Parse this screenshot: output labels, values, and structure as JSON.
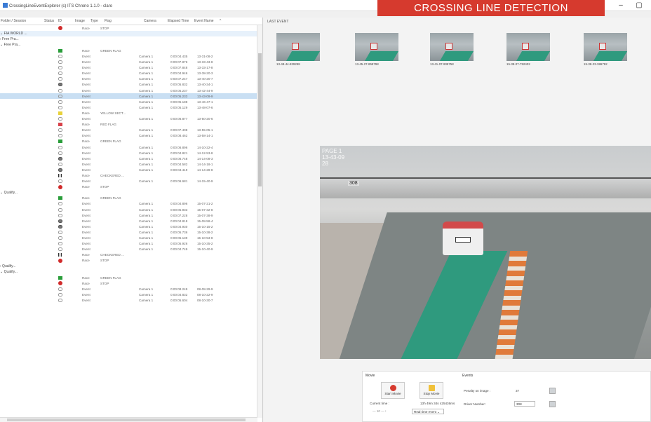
{
  "window": {
    "title": "CrossingLineEventExplorer (c) ITS Chrono 1.1.0 - claro"
  },
  "banner": {
    "text": "CROSSING LINE DETECTION"
  },
  "window_controls": {
    "minimize": "–",
    "restore": "▢"
  },
  "tree": {
    "columns": [
      "Folder / Session",
      "Status",
      "ID",
      "Image",
      "Type",
      "Flag",
      "Camera",
      "Elapsed Time",
      "Event Name"
    ],
    "sort_indicator": "^",
    "rows": [
      {
        "folder": "",
        "status": "stop",
        "type": "Race",
        "flag": "STOP",
        "camera": "",
        "elapsed": "",
        "event": ""
      },
      {
        "folder": "⌄ FIA WORLD ...",
        "status": "",
        "type": "",
        "flag": "",
        "camera": "",
        "elapsed": "",
        "event": "",
        "style": "hl"
      },
      {
        "folder": "  › Free Pra...",
        "status": "",
        "type": "",
        "flag": "",
        "camera": "",
        "elapsed": "",
        "event": ""
      },
      {
        "folder": "  ⌄ Free Pra...",
        "status": "",
        "type": "",
        "flag": "",
        "camera": "",
        "elapsed": "",
        "event": ""
      },
      {
        "folder": "",
        "status": "green",
        "type": "Race",
        "flag": "GREEN FLAG",
        "camera": "",
        "elapsed": "",
        "event": ""
      },
      {
        "folder": "",
        "status": "event",
        "type": "Event",
        "flag": "",
        "camera": "Camera 1",
        "elapsed": "0:00:04.435",
        "event": "13-31-08-2"
      },
      {
        "folder": "",
        "status": "event",
        "type": "Event",
        "flag": "",
        "camera": "Camera 1",
        "elapsed": "0:00:07.876",
        "event": "13-33-43-8"
      },
      {
        "folder": "",
        "status": "event",
        "type": "Event",
        "flag": "",
        "camera": "Camera 1",
        "elapsed": "0:00:07.848",
        "event": "13-33-17-8"
      },
      {
        "folder": "",
        "status": "event",
        "type": "Event",
        "flag": "",
        "camera": "Camera 1",
        "elapsed": "0:00:04.946",
        "event": "13-38-20-3"
      },
      {
        "folder": "",
        "status": "event",
        "type": "Event",
        "flag": "",
        "camera": "Camera 1",
        "elapsed": "0:00:07.247",
        "event": "13-40-20-7"
      },
      {
        "folder": "",
        "status": "event-dark",
        "type": "Event",
        "flag": "",
        "camera": "Camera 1",
        "elapsed": "0:00:05.832",
        "event": "13-40-34-1"
      },
      {
        "folder": "",
        "status": "event",
        "type": "Event",
        "flag": "",
        "camera": "Camera 1",
        "elapsed": "0:00:05.237",
        "event": "13-42-44-9"
      },
      {
        "folder": "",
        "status": "event",
        "type": "Event",
        "flag": "",
        "camera": "Camera 1",
        "elapsed": "0:00:05.233",
        "event": "13-43-09-9",
        "style": "sel"
      },
      {
        "folder": "",
        "status": "event",
        "type": "Event",
        "flag": "",
        "camera": "Camera 1",
        "elapsed": "0:00:05.188",
        "event": "13-46-47-1"
      },
      {
        "folder": "",
        "status": "event",
        "type": "Event",
        "flag": "",
        "camera": "Camera 1",
        "elapsed": "0:00:05.129",
        "event": "13-48-07-6"
      },
      {
        "folder": "",
        "status": "yellow",
        "type": "Race",
        "flag": "YELLOW SECT...",
        "camera": "",
        "elapsed": "",
        "event": ""
      },
      {
        "folder": "",
        "status": "event",
        "type": "Event",
        "flag": "",
        "camera": "Camera 1",
        "elapsed": "0:00:06.877",
        "event": "13-50-20-6"
      },
      {
        "folder": "",
        "status": "red",
        "type": "Race",
        "flag": "RED FLAG",
        "camera": "",
        "elapsed": "",
        "event": ""
      },
      {
        "folder": "",
        "status": "event",
        "type": "Event",
        "flag": "",
        "camera": "Camera 1",
        "elapsed": "0:00:07.408",
        "event": "13-55-05-1"
      },
      {
        "folder": "",
        "status": "event",
        "type": "Event",
        "flag": "",
        "camera": "Camera 1",
        "elapsed": "0:00:08.462",
        "event": "13-58-14-1"
      },
      {
        "folder": "",
        "status": "green",
        "type": "Race",
        "flag": "GREEN FLAG",
        "camera": "",
        "elapsed": "",
        "event": ""
      },
      {
        "folder": "",
        "status": "event",
        "type": "Event",
        "flag": "",
        "camera": "Camera 1",
        "elapsed": "0:00:06.896",
        "event": "14-10-22-4"
      },
      {
        "folder": "",
        "status": "event",
        "type": "Event",
        "flag": "",
        "camera": "Camera 1",
        "elapsed": "0:00:04.821",
        "event": "14-12-53-8"
      },
      {
        "folder": "",
        "status": "event-dark",
        "type": "Event",
        "flag": "",
        "camera": "Camera 1",
        "elapsed": "0:00:06.748",
        "event": "14-14-08-3"
      },
      {
        "folder": "",
        "status": "event",
        "type": "Event",
        "flag": "",
        "camera": "Camera 1",
        "elapsed": "0:00:04.582",
        "event": "14-14-18-1"
      },
      {
        "folder": "",
        "status": "event-dark",
        "type": "Event",
        "flag": "",
        "camera": "Camera 1",
        "elapsed": "0:00:04.419",
        "event": "14-14-28-8"
      },
      {
        "folder": "",
        "status": "check",
        "type": "Race",
        "flag": "CHECKERED ...",
        "camera": "",
        "elapsed": "",
        "event": ""
      },
      {
        "folder": "",
        "status": "event",
        "type": "Event",
        "flag": "",
        "camera": "Camera 1",
        "elapsed": "0:00:06.681",
        "event": "14-15-40-9"
      },
      {
        "folder": "",
        "status": "stop",
        "type": "Race",
        "flag": "STOP",
        "camera": "",
        "elapsed": "",
        "event": ""
      },
      {
        "folder": "  ⌄ Qualify...",
        "status": "",
        "type": "",
        "flag": "",
        "camera": "",
        "elapsed": "",
        "event": ""
      },
      {
        "folder": "",
        "status": "green",
        "type": "Race",
        "flag": "GREEN FLAG",
        "camera": "",
        "elapsed": "",
        "event": ""
      },
      {
        "folder": "",
        "status": "event",
        "type": "Event",
        "flag": "",
        "camera": "Camera 1",
        "elapsed": "0:00:04.896",
        "event": "15-07-21-2"
      },
      {
        "folder": "",
        "status": "event",
        "type": "Event",
        "flag": "",
        "camera": "Camera 1",
        "elapsed": "0:00:05.933",
        "event": "15-07-32-8"
      },
      {
        "folder": "",
        "status": "event",
        "type": "Event",
        "flag": "",
        "camera": "Camera 1",
        "elapsed": "0:00:07.228",
        "event": "15-07-38-9"
      },
      {
        "folder": "",
        "status": "event-dark",
        "type": "Event",
        "flag": "",
        "camera": "Camera 1",
        "elapsed": "0:00:04.818",
        "event": "15-08-58-4"
      },
      {
        "folder": "",
        "status": "event-dark",
        "type": "Event",
        "flag": "",
        "camera": "Camera 1",
        "elapsed": "0:00:04.930",
        "event": "15-10-15-2"
      },
      {
        "folder": "",
        "status": "event",
        "type": "Event",
        "flag": "",
        "camera": "Camera 1",
        "elapsed": "0:00:05.736",
        "event": "15-10-38-2"
      },
      {
        "folder": "",
        "status": "event",
        "type": "Event",
        "flag": "",
        "camera": "Camera 1",
        "elapsed": "0:00:05.139",
        "event": "15-10-53-8"
      },
      {
        "folder": "",
        "status": "event",
        "type": "Event",
        "flag": "",
        "camera": "Camera 1",
        "elapsed": "0:00:05.926",
        "event": "15-10-35-2"
      },
      {
        "folder": "",
        "status": "event",
        "type": "Event",
        "flag": "",
        "camera": "Camera 1",
        "elapsed": "0:00:04.749",
        "event": "15-10-40-9"
      },
      {
        "folder": "",
        "status": "check",
        "type": "Race",
        "flag": "CHECKERED ...",
        "camera": "",
        "elapsed": "",
        "event": ""
      },
      {
        "folder": "",
        "status": "stop",
        "type": "Race",
        "flag": "STOP",
        "camera": "",
        "elapsed": "",
        "event": ""
      },
      {
        "folder": "  › Qualify...",
        "status": "",
        "type": "",
        "flag": "",
        "camera": "",
        "elapsed": "",
        "event": ""
      },
      {
        "folder": "  ⌄ Qualify...",
        "status": "",
        "type": "",
        "flag": "",
        "camera": "",
        "elapsed": "",
        "event": ""
      },
      {
        "folder": "",
        "status": "green",
        "type": "Race",
        "flag": "GREEN FLAG",
        "camera": "",
        "elapsed": "",
        "event": ""
      },
      {
        "folder": "",
        "status": "stop",
        "type": "Race",
        "flag": "STOP",
        "camera": "",
        "elapsed": "",
        "event": ""
      },
      {
        "folder": "",
        "status": "event",
        "type": "Event",
        "flag": "",
        "camera": "Camera 1",
        "elapsed": "0:00:08.249",
        "event": "08-08-29-9"
      },
      {
        "folder": "",
        "status": "event",
        "type": "Event",
        "flag": "",
        "camera": "Camera 1",
        "elapsed": "0:00:04.832",
        "event": "08-10-22-9"
      },
      {
        "folder": "",
        "status": "event",
        "type": "Event",
        "flag": "",
        "camera": "Camera 1",
        "elapsed": "0:00:05.604",
        "event": "08-10-30-7"
      }
    ]
  },
  "last_event": {
    "label": "LAST EVENT",
    "thumbnails": [
      {
        "label": "13-48-44-829298"
      },
      {
        "label": "13-45-27-858798"
      },
      {
        "label": "13-41-07-908758"
      },
      {
        "label": "15-38-07-752402"
      },
      {
        "label": "15-38-23-386792"
      }
    ]
  },
  "main_image": {
    "osd_lines": [
      "PAGE 1",
      "13-43-09",
      "28"
    ],
    "sign_text": "308"
  },
  "movie": {
    "title": "Movie",
    "start_label": "Start Movie",
    "stop_label": "Stop Movie",
    "current_time_label": "Current time :",
    "current_time_value": "13h 49m 34s 425436ms",
    "speed_value": "Real time event",
    "step_value": "10",
    "colors": {
      "start": "#d63a2e",
      "stop": "#f0c13a"
    }
  },
  "events": {
    "title": "Events",
    "penalty_label": "Penalty on image :",
    "penalty_value": "37",
    "driver_label": "Driver Number :",
    "driver_value": "308"
  }
}
